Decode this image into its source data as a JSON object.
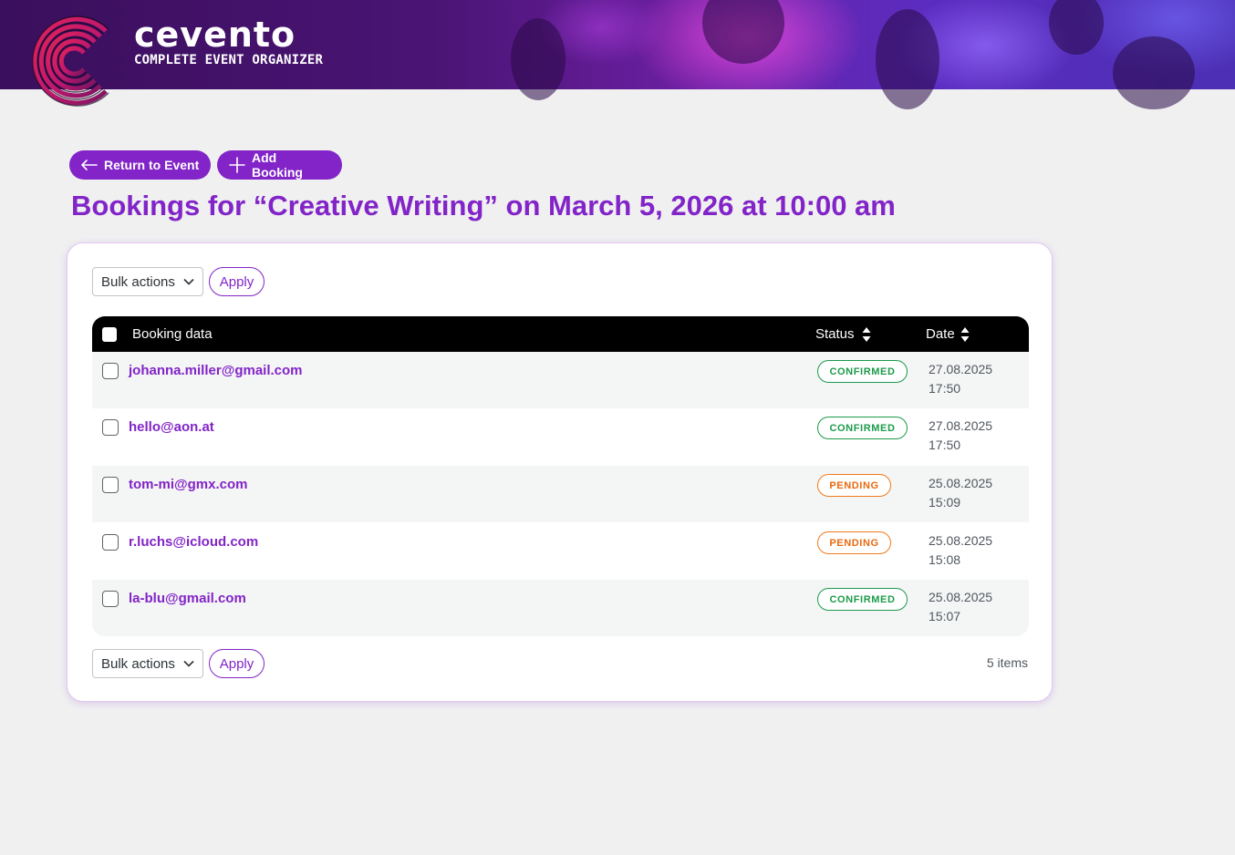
{
  "brand": {
    "name": "cevento",
    "tagline": "COMPLETE EVENT ORGANIZER"
  },
  "actions": {
    "return_label": "Return to Event",
    "add_label": "Add Booking"
  },
  "page_title": "Bookings for “Creative Writing” on March 5, 2026 at 10:00 am",
  "bulk": {
    "select_label": "Bulk actions",
    "apply_label": "Apply"
  },
  "table": {
    "headers": {
      "booking_data": "Booking data",
      "status": "Status",
      "date": "Date"
    },
    "rows": [
      {
        "email": "johanna.miller@gmail.com",
        "status": "CONFIRMED",
        "date": "27.08.2025",
        "time": "17:50"
      },
      {
        "email": "hello@aon.at",
        "status": "CONFIRMED",
        "date": "27.08.2025",
        "time": "17:50"
      },
      {
        "email": "tom-mi@gmx.com",
        "status": "PENDING",
        "date": "25.08.2025",
        "time": "15:09"
      },
      {
        "email": "r.luchs@icloud.com",
        "status": "PENDING",
        "date": "25.08.2025",
        "time": "15:08"
      },
      {
        "email": "la-blu@gmail.com",
        "status": "CONFIRMED",
        "date": "25.08.2025",
        "time": "15:07"
      }
    ]
  },
  "items_count": "5 items",
  "colors": {
    "accent": "#8224c8",
    "confirmed": "#1c9a4a",
    "pending": "#e8690f",
    "header_bg": "#000000",
    "page_bg": "#f0f0f1"
  },
  "icons": {
    "return": "arrow-left-icon",
    "add": "plus-icon",
    "dropdown": "chevron-down-icon",
    "sort": "sort-icon"
  }
}
